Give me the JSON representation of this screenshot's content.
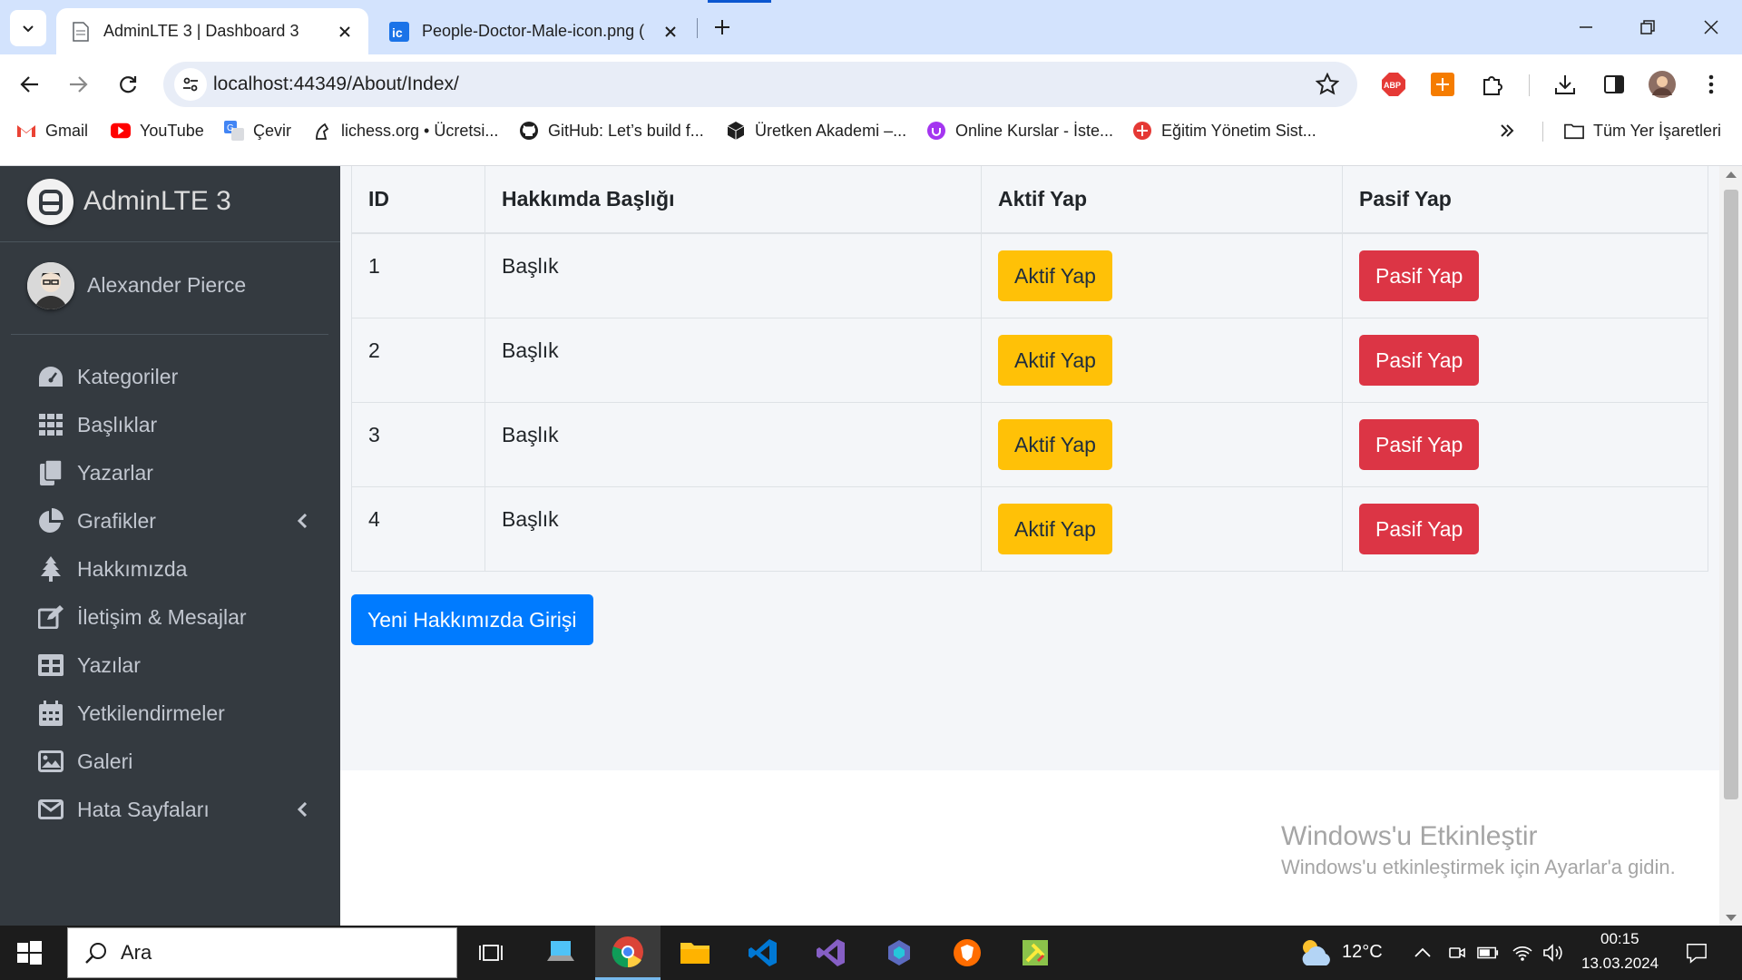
{
  "browser": {
    "tabs": [
      {
        "title": "AdminLTE 3 | Dashboard 3",
        "active": true
      },
      {
        "title": "People-Doctor-Male-icon.png (",
        "active": false
      }
    ],
    "address": "localhost:44349/About/Index/",
    "bookmarks": [
      {
        "label": "Gmail",
        "icon": "gmail-icon"
      },
      {
        "label": "YouTube",
        "icon": "youtube-icon"
      },
      {
        "label": "Çevir",
        "icon": "translate-icon"
      },
      {
        "label": "lichess.org • Ücretsi...",
        "icon": "lichess-icon"
      },
      {
        "label": "GitHub: Let’s build f...",
        "icon": "github-icon"
      },
      {
        "label": "Üretken Akademi –...",
        "icon": "cube-icon"
      },
      {
        "label": "Online Kurslar - İste...",
        "icon": "udemy-icon"
      },
      {
        "label": "Eğitim Yönetim Sist...",
        "icon": "edu-icon"
      }
    ],
    "all_bookmarks": "Tüm Yer İşaretleri",
    "colors": {
      "tabstrip": "#d3e3fd",
      "omnibox": "#e8edf7"
    }
  },
  "sidebar": {
    "brand": "AdminLTE 3",
    "user": "Alexander Pierce",
    "items": [
      {
        "label": "Kategoriler",
        "icon": "tachometer-icon",
        "caret": false
      },
      {
        "label": "Başlıklar",
        "icon": "grid-icon",
        "caret": false
      },
      {
        "label": "Yazarlar",
        "icon": "copy-icon",
        "caret": false
      },
      {
        "label": "Grafikler",
        "icon": "pie-chart-icon",
        "caret": true
      },
      {
        "label": "Hakkımızda",
        "icon": "tree-icon",
        "caret": false
      },
      {
        "label": "İletişim & Mesajlar",
        "icon": "edit-icon",
        "caret": false
      },
      {
        "label": "Yazılar",
        "icon": "table-icon",
        "caret": false
      },
      {
        "label": "Yetkilendirmeler",
        "icon": "calendar-icon",
        "caret": false
      },
      {
        "label": "Galeri",
        "icon": "image-icon",
        "caret": false
      },
      {
        "label": "Hata Sayfaları",
        "icon": "envelope-icon",
        "caret": true
      }
    ]
  },
  "table": {
    "headers": [
      "ID",
      "Hakkımda Başlığı",
      "Aktif Yap",
      "Pasif Yap"
    ],
    "rows": [
      {
        "id": "1",
        "title": "Başlık",
        "activate": "Aktif Yap",
        "deactivate": "Pasif Yap"
      },
      {
        "id": "2",
        "title": "Başlık",
        "activate": "Aktif Yap",
        "deactivate": "Pasif Yap"
      },
      {
        "id": "3",
        "title": "Başlık",
        "activate": "Aktif Yap",
        "deactivate": "Pasif Yap"
      },
      {
        "id": "4",
        "title": "Başlık",
        "activate": "Aktif Yap",
        "deactivate": "Pasif Yap"
      }
    ]
  },
  "new_entry_button": "Yeni Hakkımızda Girişi",
  "watermark": {
    "title": "Windows'u Etkinleştir",
    "subtitle": "Windows'u etkinleştirmek için Ayarlar'a gidin."
  },
  "taskbar": {
    "search_placeholder": "Ara",
    "weather": "12°C",
    "time": "00:15",
    "date": "13.03.2024"
  },
  "colors": {
    "sidebar": "#343a40",
    "content": "#f4f6f9",
    "warning": "#ffc107",
    "danger": "#dc3545",
    "primary": "#007bff"
  }
}
